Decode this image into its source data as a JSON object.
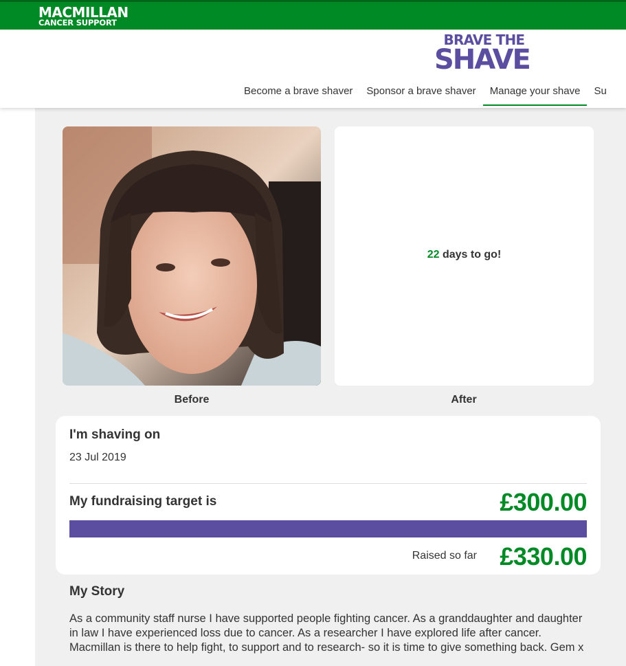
{
  "brand": {
    "org_line1": "MACMILLAN",
    "org_line2": "CANCER SUPPORT",
    "campaign_line1": "BRAVE THE",
    "campaign_line2": "SHAVE",
    "green": "#008a26",
    "purple": "#5b4d9f"
  },
  "nav": {
    "items": [
      {
        "label": "Become a brave shaver",
        "active": false
      },
      {
        "label": "Sponsor a brave shaver",
        "active": false
      },
      {
        "label": "Manage your shave",
        "active": true
      },
      {
        "label": "Su",
        "active": false
      }
    ]
  },
  "photos": {
    "before_caption": "Before",
    "after_caption": "After",
    "days_number": "22",
    "days_text": " days to go!"
  },
  "shave": {
    "heading": "I'm shaving on",
    "date": "23 Jul 2019",
    "target_label": "My fundraising target is",
    "target_value": "£300.00",
    "progress_fraction": 1.0,
    "raised_label": "Raised so far",
    "raised_value": "£330.00"
  },
  "story": {
    "heading": "My Story",
    "text": "As a community staff nurse I have supported people fighting cancer. As a granddaughter and daughter in law I have experienced loss due to cancer. As a researcher I have explored life after cancer. Macmillan is there to help fight, to support and to research- so it is time to give something back. Gem x"
  }
}
